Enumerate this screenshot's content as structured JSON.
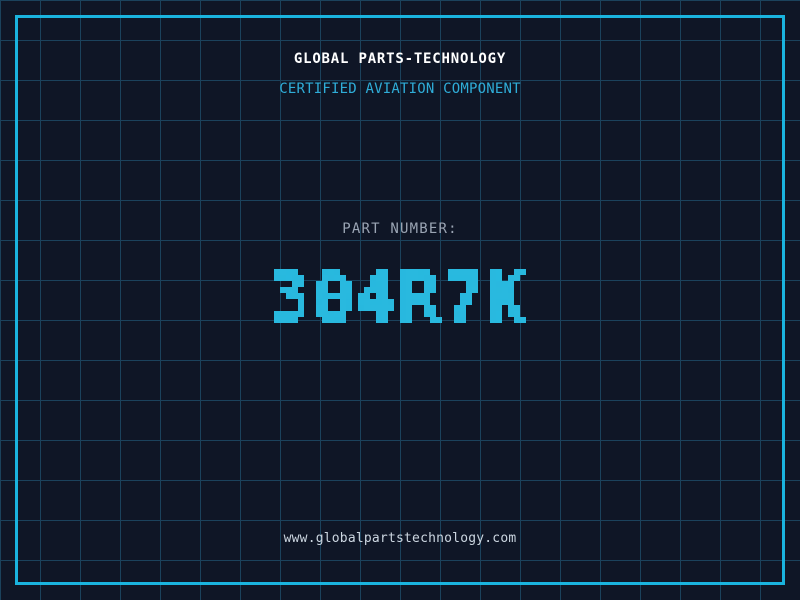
{
  "colors": {
    "background": "#0f1626",
    "grid_line": "#1b425c",
    "frame": "#1ab3de",
    "title": "#ffffff",
    "subtitle": "#2fadd8",
    "label": "#9ba5b4",
    "part_number": "#29b9df",
    "url": "#ccd6e0"
  },
  "header": {
    "title": "GLOBAL PARTS-TECHNOLOGY",
    "subtitle": "CERTIFIED AVIATION COMPONENT"
  },
  "part": {
    "label": "PART NUMBER:",
    "number": "304R7K"
  },
  "footer": {
    "url": "www.globalpartstechnology.com"
  }
}
